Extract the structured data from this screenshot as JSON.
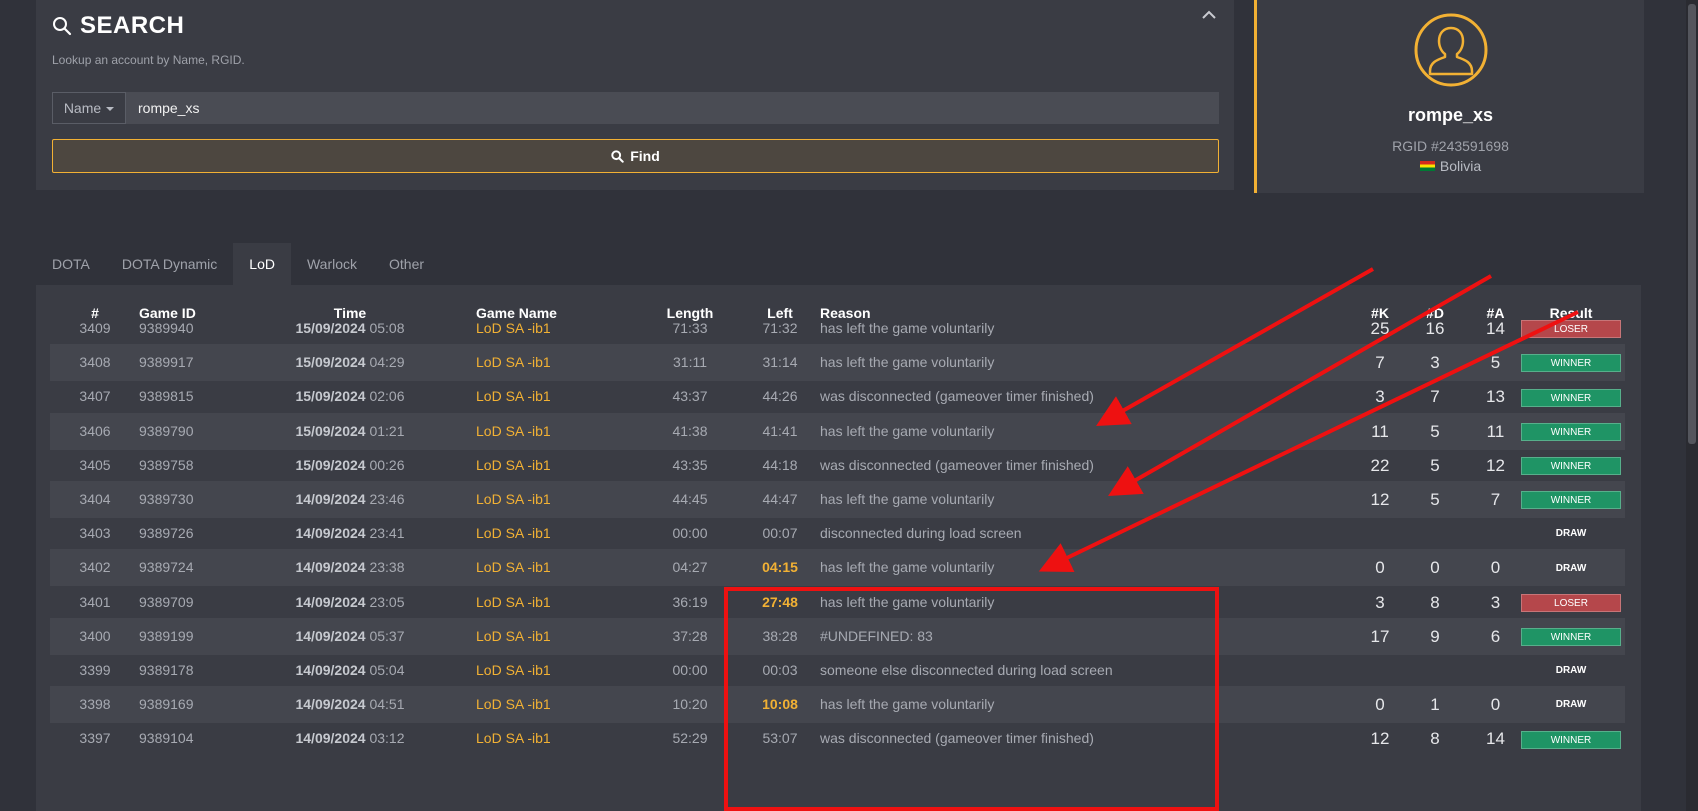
{
  "search": {
    "title": "SEARCH",
    "subtitle": "Lookup an account by Name, RGID.",
    "select_value": "Name",
    "input_value": "rompe_xs",
    "find_label": "Find",
    "icons": {
      "search": "search-icon",
      "collapse": "chevron-up-icon"
    }
  },
  "profile": {
    "name": "rompe_xs",
    "rgid": "RGID #243591698",
    "country": "Bolivia",
    "avatar_icon": "user-icon",
    "accent": "#f2b134"
  },
  "tabs": [
    {
      "label": "DOTA",
      "active": false
    },
    {
      "label": "DOTA Dynamic",
      "active": false
    },
    {
      "label": "LoD",
      "active": true
    },
    {
      "label": "Warlock",
      "active": false
    },
    {
      "label": "Other",
      "active": false
    }
  ],
  "table": {
    "columns": [
      "#",
      "Game ID",
      "Time",
      "Game Name",
      "Length",
      "Left",
      "Reason",
      "#K",
      "#D",
      "#A",
      "Result"
    ],
    "rows": [
      {
        "num": "3409",
        "gid": "9389940",
        "date": "15/09/2024",
        "time": "05:08",
        "name": "LoD SA -ib1",
        "len": "71:33",
        "left": "71:32",
        "left_hl": false,
        "reason": "has left the game voluntarily",
        "k": "25",
        "d": "16",
        "a": "14",
        "result": "LOSER"
      },
      {
        "num": "3408",
        "gid": "9389917",
        "date": "15/09/2024",
        "time": "04:29",
        "name": "LoD SA -ib1",
        "len": "31:11",
        "left": "31:14",
        "left_hl": false,
        "reason": "has left the game voluntarily",
        "k": "7",
        "d": "3",
        "a": "5",
        "result": "WINNER"
      },
      {
        "num": "3407",
        "gid": "9389815",
        "date": "15/09/2024",
        "time": "02:06",
        "name": "LoD SA -ib1",
        "len": "43:37",
        "left": "44:26",
        "left_hl": false,
        "reason": "was disconnected (gameover timer finished)",
        "k": "3",
        "d": "7",
        "a": "13",
        "result": "WINNER"
      },
      {
        "num": "3406",
        "gid": "9389790",
        "date": "15/09/2024",
        "time": "01:21",
        "name": "LoD SA -ib1",
        "len": "41:38",
        "left": "41:41",
        "left_hl": false,
        "reason": "has left the game voluntarily",
        "k": "11",
        "d": "5",
        "a": "11",
        "result": "WINNER"
      },
      {
        "num": "3405",
        "gid": "9389758",
        "date": "15/09/2024",
        "time": "00:26",
        "name": "LoD SA -ib1",
        "len": "43:35",
        "left": "44:18",
        "left_hl": false,
        "reason": "was disconnected (gameover timer finished)",
        "k": "22",
        "d": "5",
        "a": "12",
        "result": "WINNER"
      },
      {
        "num": "3404",
        "gid": "9389730",
        "date": "14/09/2024",
        "time": "23:46",
        "name": "LoD SA -ib1",
        "len": "44:45",
        "left": "44:47",
        "left_hl": false,
        "reason": "has left the game voluntarily",
        "k": "12",
        "d": "5",
        "a": "7",
        "result": "WINNER"
      },
      {
        "num": "3403",
        "gid": "9389726",
        "date": "14/09/2024",
        "time": "23:41",
        "name": "LoD SA -ib1",
        "len": "00:00",
        "left": "00:07",
        "left_hl": false,
        "reason": "disconnected during load screen",
        "k": "",
        "d": "",
        "a": "",
        "result": "DRAW"
      },
      {
        "num": "3402",
        "gid": "9389724",
        "date": "14/09/2024",
        "time": "23:38",
        "name": "LoD SA -ib1",
        "len": "04:27",
        "left": "04:15",
        "left_hl": true,
        "reason": "has left the game voluntarily",
        "k": "0",
        "d": "0",
        "a": "0",
        "result": "DRAW"
      },
      {
        "num": "3401",
        "gid": "9389709",
        "date": "14/09/2024",
        "time": "23:05",
        "name": "LoD SA -ib1",
        "len": "36:19",
        "left": "27:48",
        "left_hl": true,
        "reason": "has left the game voluntarily",
        "k": "3",
        "d": "8",
        "a": "3",
        "result": "LOSER"
      },
      {
        "num": "3400",
        "gid": "9389199",
        "date": "14/09/2024",
        "time": "05:37",
        "name": "LoD SA -ib1",
        "len": "37:28",
        "left": "38:28",
        "left_hl": false,
        "reason": "#UNDEFINED: 83",
        "k": "17",
        "d": "9",
        "a": "6",
        "result": "WINNER"
      },
      {
        "num": "3399",
        "gid": "9389178",
        "date": "14/09/2024",
        "time": "05:04",
        "name": "LoD SA -ib1",
        "len": "00:00",
        "left": "00:03",
        "left_hl": false,
        "reason": "someone else disconnected during load screen",
        "k": "",
        "d": "",
        "a": "",
        "result": "DRAW"
      },
      {
        "num": "3398",
        "gid": "9389169",
        "date": "14/09/2024",
        "time": "04:51",
        "name": "LoD SA -ib1",
        "len": "10:20",
        "left": "10:08",
        "left_hl": true,
        "reason": "has left the game voluntarily",
        "k": "0",
        "d": "1",
        "a": "0",
        "result": "DRAW"
      },
      {
        "num": "3397",
        "gid": "9389104",
        "date": "14/09/2024",
        "time": "03:12",
        "name": "LoD SA -ib1",
        "len": "52:29",
        "left": "53:07",
        "left_hl": false,
        "reason": "was disconnected (gameover timer finished)",
        "k": "12",
        "d": "8",
        "a": "14",
        "result": "WINNER"
      }
    ]
  },
  "colors": {
    "winner": "#1f9465",
    "loser": "#b5474b",
    "accent": "#f2b134",
    "annotation": "#ee1111"
  }
}
